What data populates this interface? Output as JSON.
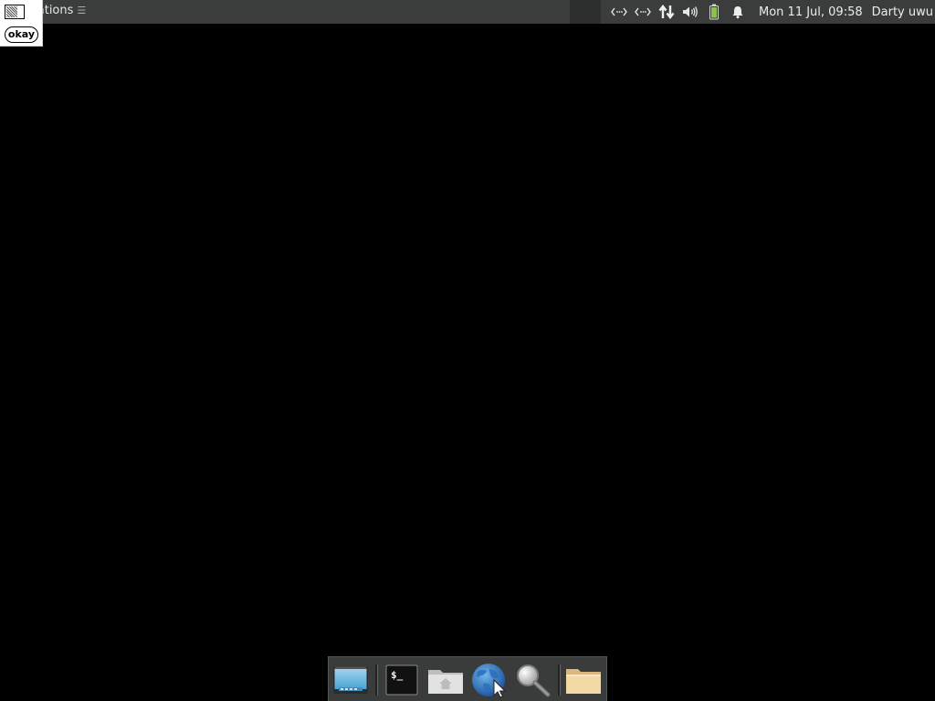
{
  "top_panel": {
    "applications_label": "ications",
    "applications_grip": "☰",
    "clock": "Mon 11 Jul, 09:58",
    "user": "Darty uwu",
    "tray_icons": [
      "network-wired-icon",
      "network-wired-icon",
      "network-transfer-icon",
      "volume-icon",
      "battery-icon",
      "notification-bell-icon"
    ]
  },
  "popup": {
    "button_label": "okay"
  },
  "dock": {
    "items": [
      {
        "name": "show-desktop-icon"
      },
      {
        "name": "terminal-icon",
        "text": "$_"
      },
      {
        "name": "home-folder-icon"
      },
      {
        "name": "web-browser-icon"
      },
      {
        "name": "search-icon"
      },
      {
        "name": "file-manager-folder-icon"
      }
    ]
  },
  "colors": {
    "panel_bg": "#3b3d3d",
    "desktop_bg": "#000000",
    "battery": "#8bc34a"
  }
}
